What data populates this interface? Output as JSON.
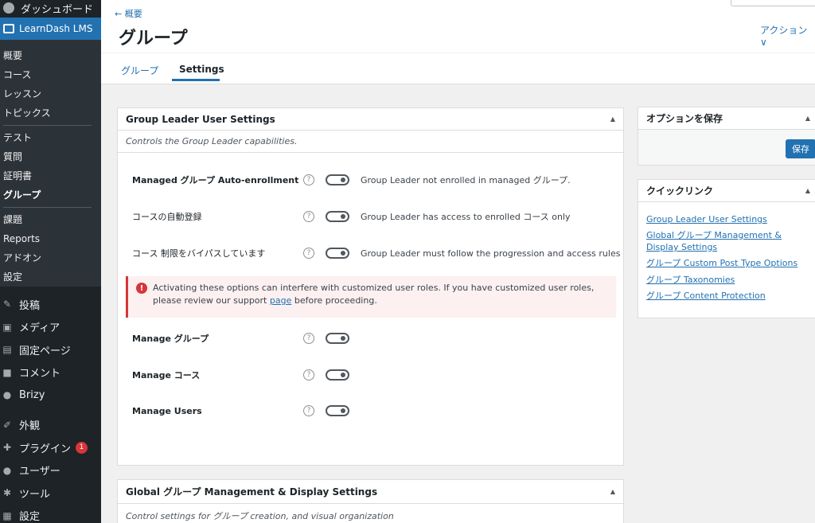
{
  "sidebar": {
    "dashboard": "ダッシュボード",
    "learndash": "LearnDash LMS",
    "sub_items": [
      {
        "label": "概要"
      },
      {
        "label": "コース"
      },
      {
        "label": "レッスン"
      },
      {
        "label": "トピックス"
      },
      {
        "label": "テスト"
      },
      {
        "label": "質問"
      },
      {
        "label": "証明書"
      },
      {
        "label": "グループ"
      },
      {
        "label": "課題"
      },
      {
        "label": "Reports"
      },
      {
        "label": "アドオン"
      },
      {
        "label": "設定"
      }
    ],
    "main_items": [
      {
        "label": "投稿",
        "icon": "pin-icon"
      },
      {
        "label": "メディア",
        "icon": "media-icon"
      },
      {
        "label": "固定ページ",
        "icon": "page-icon"
      },
      {
        "label": "コメント",
        "icon": "comment-icon"
      },
      {
        "label": "Brizy",
        "icon": "brizy-icon"
      },
      {
        "label": "外観",
        "icon": "appearance-icon"
      },
      {
        "label": "プラグイン",
        "icon": "plugin-icon",
        "badge": "1"
      },
      {
        "label": "ユーザー",
        "icon": "user-icon"
      },
      {
        "label": "ツール",
        "icon": "tool-icon"
      },
      {
        "label": "設定",
        "icon": "settings-icon"
      }
    ]
  },
  "header": {
    "back": "← 概要",
    "title": "グループ",
    "action": "アクション ∨",
    "tabs": [
      "グループ",
      "Settings"
    ]
  },
  "leader_panel": {
    "title": "Group Leader User Settings",
    "desc": "Controls the Group Leader capabilities.",
    "rows": [
      {
        "label": "Managed グループ Auto-enrollment",
        "desc": "Group Leader not enrolled in managed グループ."
      },
      {
        "label": "コースの自動登録",
        "desc": "Group Leader has access to enrolled コース only"
      },
      {
        "label": "コース 制限をバイパスしています",
        "desc": "Group Leader must follow the progression and access rules"
      },
      {
        "label": "Manage グループ",
        "desc": ""
      },
      {
        "label": "Manage コース",
        "desc": ""
      },
      {
        "label": "Manage Users",
        "desc": ""
      }
    ],
    "notice_before": "Activating these options can interfere with customized user roles. If you have customized user roles, please review our support ",
    "notice_link": "page",
    "notice_after": " before proceeding."
  },
  "global_panel": {
    "title": "Global グループ Management & Display Settings",
    "desc": "Control settings for グループ creation, and visual organization"
  },
  "save_panel": {
    "title": "オプションを保存",
    "button": "保存"
  },
  "quick_panel": {
    "title": "クイックリンク",
    "links": [
      "Group Leader User Settings",
      "Global グループ Management & Display Settings",
      "グループ Custom Post Type Options",
      "グループ Taxonomies",
      "グループ Content Protection"
    ]
  },
  "colors": {
    "accent": "#2271b1",
    "sidebar": "#1d2327",
    "error": "#d63638"
  }
}
